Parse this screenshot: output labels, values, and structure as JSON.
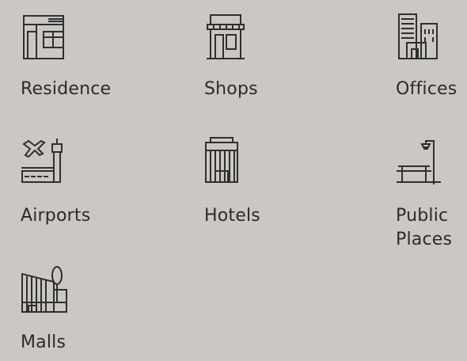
{
  "categories": [
    {
      "label": "Residence",
      "icon": "residence-icon"
    },
    {
      "label": "Shops",
      "icon": "shop-icon"
    },
    {
      "label": "Offices",
      "icon": "office-building-icon"
    },
    {
      "label": "Airports",
      "icon": "airport-icon"
    },
    {
      "label": "Hotels",
      "icon": "hotel-icon"
    },
    {
      "label": "Public Places",
      "icon": "park-bench-streetlight-icon"
    },
    {
      "label": "Malls",
      "icon": "mall-icon"
    }
  ],
  "colors": {
    "background": "#cbc7c2",
    "ink": "#2f2f2f"
  }
}
